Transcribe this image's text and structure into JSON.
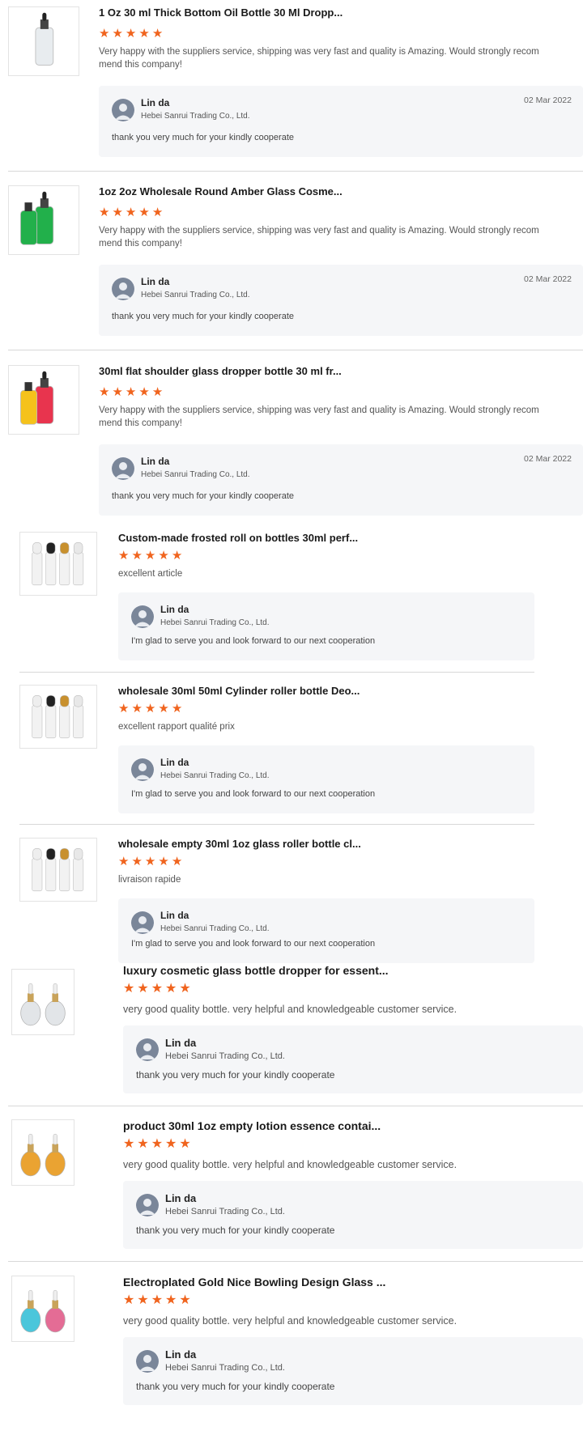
{
  "reviews": [
    {
      "title": "1 Oz 30 ml Thick Bottom Oil Bottle 30 Ml Dropp...",
      "rating": 5,
      "text": "Very happy with the suppliers service, shipping was very fast and quality is Amazing. Would strongly recom mend this company!",
      "reply": {
        "name": "Lin da",
        "company": "Hebei Sanrui Trading Co., Ltd.",
        "date": "02 Mar 2022",
        "message": "thank you very much for your kindly cooperate"
      },
      "thumb_colors": [
        "#e8ecef"
      ]
    },
    {
      "title": "1oz 2oz Wholesale Round Amber Glass Cosme...",
      "rating": 5,
      "text": "Very happy with the suppliers service, shipping was very fast and quality is Amazing. Would strongly recom mend this company!",
      "reply": {
        "name": "Lin da",
        "company": "Hebei Sanrui Trading Co., Ltd.",
        "date": "02 Mar 2022",
        "message": "thank you very much for your kindly cooperate"
      },
      "thumb_colors": [
        "#22b04b"
      ]
    },
    {
      "title": "30ml flat shoulder glass dropper bottle 30 ml fr...",
      "rating": 5,
      "text": "Very happy with the suppliers service, shipping was very fast and quality is Amazing. Would strongly recom mend this company!",
      "reply": {
        "name": "Lin da",
        "company": "Hebei Sanrui Trading Co., Ltd.",
        "date": "02 Mar 2022",
        "message": "thank you very much for your kindly cooperate"
      },
      "thumb_colors": [
        "#e8344e",
        "#f5c21b"
      ]
    },
    {
      "title": "Custom-made frosted roll on bottles 30ml perf...",
      "rating": 5,
      "text": "excellent article",
      "reply": {
        "name": "Lin da",
        "company": "Hebei Sanrui Trading Co., Ltd.",
        "date": "",
        "message": "I'm glad to serve you and look forward to our next cooperation"
      },
      "thumb_colors": [
        "#f2f2f2"
      ]
    },
    {
      "title": "wholesale 30ml 50ml Cylinder roller bottle Deo...",
      "rating": 5,
      "text": "excellent rapport qualité prix",
      "reply": {
        "name": "Lin da",
        "company": "Hebei Sanrui Trading Co., Ltd.",
        "date": "",
        "message": "I'm glad to serve you and look forward to our next cooperation"
      },
      "thumb_colors": [
        "#f2f2f2"
      ]
    },
    {
      "title": "wholesale empty 30ml 1oz glass roller bottle cl...",
      "rating": 5,
      "text": "livraison rapide",
      "reply": {
        "name": "Lin da",
        "company": "Hebei Sanrui Trading Co., Ltd.",
        "date": "",
        "message": "I'm glad to serve you and look forward to our next cooperation"
      },
      "thumb_colors": [
        "#f2f2f2"
      ]
    },
    {
      "title": "luxury cosmetic glass bottle dropper for essent...",
      "rating": 5,
      "text": "very good quality bottle. very helpful and knowledgeable customer service.",
      "reply": {
        "name": "Lin da",
        "company": "Hebei Sanrui Trading Co., Ltd.",
        "date": "",
        "message": "thank you very much for your kindly cooperate"
      },
      "thumb_colors": [
        "#dfe3e6"
      ]
    },
    {
      "title": "product 30ml 1oz empty lotion essence contai...",
      "rating": 5,
      "text": "very good quality bottle. very helpful and knowledgeable customer service.",
      "reply": {
        "name": "Lin da",
        "company": "Hebei Sanrui Trading Co., Ltd.",
        "date": "",
        "message": "thank you very much for your kindly cooperate"
      },
      "thumb_colors": [
        "#e89a1c"
      ]
    },
    {
      "title": "Electroplated Gold Nice Bowling Design Glass ...",
      "rating": 5,
      "text": "very good quality bottle. very helpful and knowledgeable customer service.",
      "reply": {
        "name": "Lin da",
        "company": "Hebei Sanrui Trading Co., Ltd.",
        "date": "",
        "message": "thank you very much for your kindly cooperate"
      },
      "thumb_colors": [
        "#38c0d8",
        "#e25d8a"
      ]
    }
  ],
  "colors": {
    "star": "#f0641e",
    "reply_bg": "#f5f6f8",
    "separator": "#d8d8d8"
  }
}
